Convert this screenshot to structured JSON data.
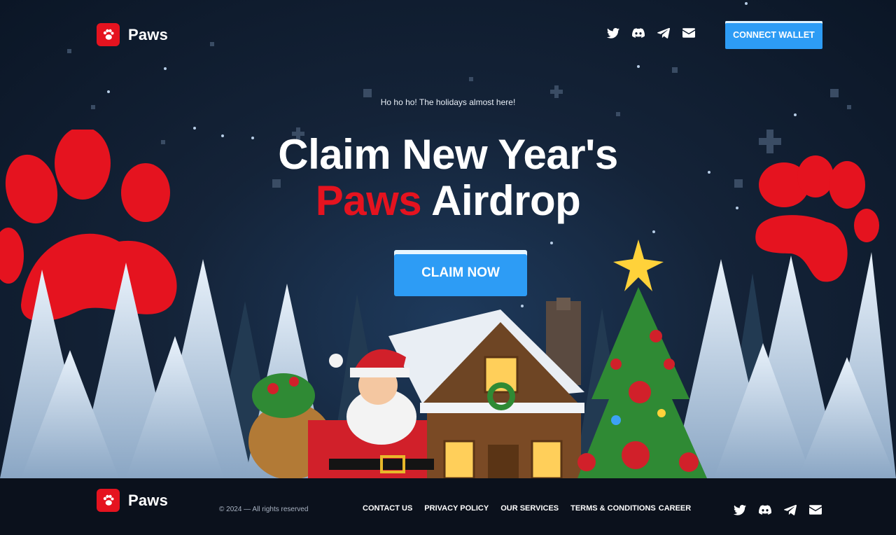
{
  "brand": {
    "name": "Paws",
    "logo_icon": "paw-icon",
    "accent": "#e5131f"
  },
  "header": {
    "social_icons": [
      "twitter-icon",
      "discord-icon",
      "telegram-icon",
      "mail-icon"
    ],
    "connect_label": "CONNECT WALLET",
    "button_color": "#2d9cf5"
  },
  "hero": {
    "kicker": "Ho ho ho! The holidays almost here!",
    "headline_line1": "Claim New Year's",
    "headline_accent": "Paws",
    "headline_rest": " Airdrop",
    "cta_label": "CLAIM NOW"
  },
  "footer": {
    "brand_name": "Paws",
    "copyright": "© 2024 — All rights reserved",
    "links": [
      "CONTACT US",
      "PRIVACY POLICY",
      "OUR SERVICES",
      "TERMS & CONDITIONS",
      "CAREER"
    ],
    "social_icons": [
      "twitter-icon",
      "discord-icon",
      "telegram-icon",
      "mail-icon"
    ]
  }
}
